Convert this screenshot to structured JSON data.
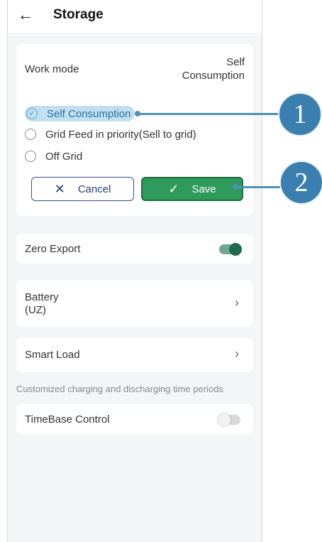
{
  "header": {
    "back_icon": "←",
    "title": "Storage"
  },
  "work_mode": {
    "label": "Work mode",
    "value_line1": "Self",
    "value_line2": "Consumption",
    "options": [
      {
        "label": "Self Consumption",
        "selected": true
      },
      {
        "label": "Grid Feed in priority(Sell to grid)",
        "selected": false
      },
      {
        "label": "Off Grid",
        "selected": false
      }
    ],
    "cancel_label": "Cancel",
    "save_label": "Save"
  },
  "zero_export": {
    "label": "Zero Export",
    "enabled": true
  },
  "battery": {
    "label_line1": "Battery",
    "label_line2": "(UZ)"
  },
  "smart_load": {
    "label": "Smart Load"
  },
  "caption": "Customized charging and discharging time periods",
  "timebase": {
    "label": "TimeBase Control",
    "enabled": false
  },
  "callouts": {
    "one": "1",
    "two": "2"
  },
  "colors": {
    "accent_green": "#2e9a5c",
    "toggle_on": "#2a7a5a",
    "highlight": "#bfe0f1",
    "callout": "#3a7fb0"
  }
}
